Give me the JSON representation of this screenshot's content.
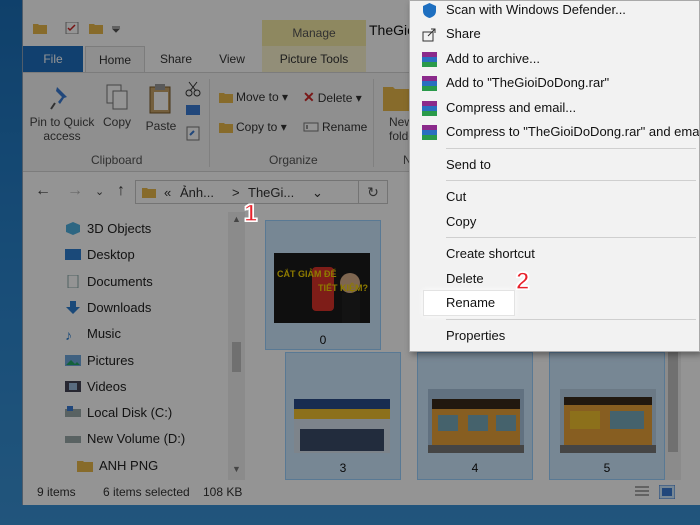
{
  "window": {
    "title": "TheGio",
    "manage_tab": "Manage",
    "quick_access_icons": [
      "folder-icon",
      "properties-icon",
      "folder-icon",
      "dropdown-icon"
    ]
  },
  "ribbon": {
    "tabs": [
      "File",
      "Home",
      "Share",
      "View",
      "Picture Tools"
    ],
    "clipboard": {
      "pin_label_1": "Pin to Quick",
      "pin_label_2": "access",
      "copy": "Copy",
      "paste": "Paste",
      "group": "Clipboard"
    },
    "organize": {
      "move_to": "Move to",
      "delete": "Delete",
      "copy_to": "Copy to",
      "rename": "Rename",
      "group": "Organize"
    },
    "new": {
      "label_1": "New",
      "label_2": "folde",
      "group": "N"
    }
  },
  "address": {
    "chevrons": "«",
    "crumb_1": "Ảnh...",
    "sep": ">",
    "crumb_2": "TheGi..."
  },
  "nav_pane": {
    "items": [
      {
        "label": "3D Objects",
        "icon": "cube-icon"
      },
      {
        "label": "Desktop",
        "icon": "desktop-icon"
      },
      {
        "label": "Documents",
        "icon": "documents-icon"
      },
      {
        "label": "Downloads",
        "icon": "downloads-icon"
      },
      {
        "label": "Music",
        "icon": "music-icon"
      },
      {
        "label": "Pictures",
        "icon": "pictures-icon"
      },
      {
        "label": "Videos",
        "icon": "videos-icon"
      },
      {
        "label": "Local Disk (C:)",
        "icon": "drive-icon"
      },
      {
        "label": "New Volume (D:)",
        "icon": "drive-icon"
      },
      {
        "label": "ANH PNG",
        "icon": "folder-icon"
      }
    ]
  },
  "files": [
    {
      "name": "0",
      "thumb_text_1": "CẮT GIẢM ĐỂ",
      "thumb_text_2": "TIẾT KIỆM?"
    },
    {
      "name": "3"
    },
    {
      "name": "4"
    },
    {
      "name": "5"
    }
  ],
  "status": {
    "items": "9 items",
    "selected": "6 items selected",
    "size": "108 KB"
  },
  "context_menu": {
    "items": [
      {
        "label": "Scan with Windows Defender...",
        "icon": "defender-icon"
      },
      {
        "label": "Share",
        "icon": "share-icon"
      },
      {
        "label": "Add to archive...",
        "icon": "winrar-icon"
      },
      {
        "label": "Add to \"TheGioiDoDong.rar\"",
        "icon": "winrar-icon"
      },
      {
        "label": "Compress and email...",
        "icon": "winrar-icon"
      },
      {
        "label": "Compress to \"TheGioiDoDong.rar\" and ema",
        "icon": "winrar-icon"
      },
      {
        "label": "Send to",
        "icon": ""
      },
      {
        "label": "Cut",
        "icon": ""
      },
      {
        "label": "Copy",
        "icon": ""
      },
      {
        "label": "Create shortcut",
        "icon": ""
      },
      {
        "label": "Delete",
        "icon": ""
      },
      {
        "label": "Rename",
        "icon": ""
      },
      {
        "label": "Properties",
        "icon": ""
      }
    ]
  },
  "annotations": {
    "step_1": "1",
    "step_2": "2"
  },
  "colors": {
    "accent": "#1e6fc0",
    "selection": "#cde8ff",
    "step_red": "#e8202a",
    "manage_yellow": "#f5eaa6"
  }
}
